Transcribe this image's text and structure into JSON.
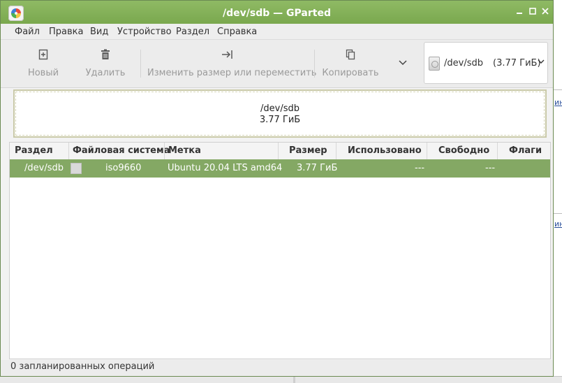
{
  "window": {
    "title": "/dev/sdb — GParted",
    "app_icon": "gparted-icon",
    "controls": [
      "minimize-icon",
      "maximize-icon",
      "close-icon"
    ],
    "accent_color": "#84a864"
  },
  "menubar": {
    "items": [
      "Файл",
      "Правка",
      "Вид",
      "Устройство",
      "Раздел",
      "Справка"
    ]
  },
  "toolbar": {
    "new_label": "Новый",
    "delete_label": "Удалить",
    "resize_label": "Изменить размер или переместить",
    "copy_label": "Копировать",
    "icons": [
      "new-partition-icon",
      "trash-icon",
      "resize-arrow-icon",
      "copy-icon",
      "chevron-down-icon"
    ]
  },
  "device_selector": {
    "device": "/dev/sdb",
    "size": "(3.77 ГиБ)",
    "icon": "disk-icon"
  },
  "disk_map": {
    "device": "/dev/sdb",
    "size": "3.77 ГиБ"
  },
  "table": {
    "headers": [
      "Раздел",
      "Файловая система",
      "Метка",
      "Размер",
      "Использовано",
      "Свободно",
      "Флаги"
    ],
    "rows": [
      {
        "partition": "/dev/sdb",
        "filesystem": "iso9660",
        "label": "Ubuntu 20.04 LTS amd64",
        "size": "3.77 ГиБ",
        "used": "---",
        "free": "---",
        "flags": ""
      }
    ]
  },
  "status": {
    "text": "0 запланированных операций"
  }
}
